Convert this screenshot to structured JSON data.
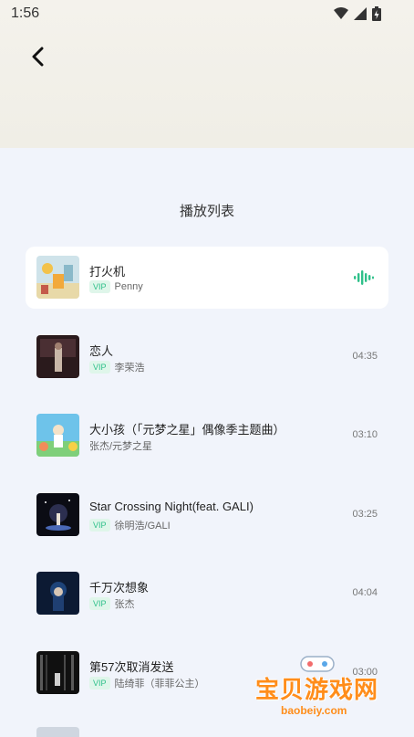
{
  "status_bar": {
    "time": "1:56"
  },
  "panel": {
    "title": "播放列表"
  },
  "playlist": [
    {
      "title": "打火机",
      "vip": "VIP",
      "artist": "Penny",
      "duration": "",
      "playing": true
    },
    {
      "title": "恋人",
      "vip": "VIP",
      "artist": "李荣浩",
      "duration": "04:35",
      "playing": false
    },
    {
      "title": "大小孩（「元梦之星」偶像季主题曲）",
      "vip": "",
      "artist": "张杰/元梦之星",
      "duration": "03:10",
      "playing": false
    },
    {
      "title": "Star Crossing Night(feat. GALI)",
      "vip": "VIP",
      "artist": "徐明浩/GALI",
      "duration": "03:25",
      "playing": false
    },
    {
      "title": "千万次想象",
      "vip": "VIP",
      "artist": "张杰",
      "duration": "04:04",
      "playing": false
    },
    {
      "title": "第57次取消发送",
      "vip": "VIP",
      "artist": "陆绮菲（菲菲公主）",
      "duration": "03:00",
      "playing": false
    }
  ],
  "watermark": {
    "text": "宝贝游戏网",
    "url": "baobeiy.com"
  },
  "colors": {
    "accent": "#2fc08a",
    "background": "#f1f4fb",
    "header": "#f2f0e8"
  }
}
